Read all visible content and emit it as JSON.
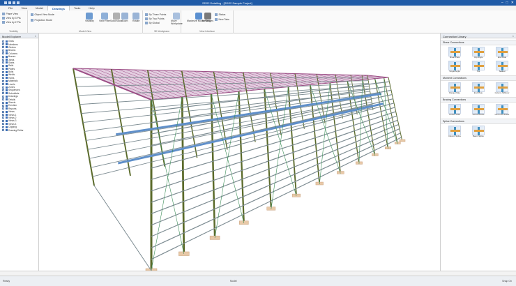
{
  "app": {
    "title": "SDS2 Detailing - [SDS2 Sample Project]",
    "window_controls": [
      "–",
      "□",
      "✕"
    ]
  },
  "menu": {
    "tabs": [
      "File",
      "View",
      "Model",
      "Drawings",
      "Tools",
      "Help"
    ],
    "active_index": 3
  },
  "ribbon": {
    "groups": [
      {
        "label": "Visibility"
      },
      {
        "label": "Model View"
      },
      {
        "label": "3D Workplane"
      },
      {
        "label": "View Interface"
      }
    ],
    "buttons": {
      "plane_view": "Plane View",
      "view_by_3pts": "View by 3 Pts",
      "view_by_2pts": "View by 2 Pts",
      "object_view": "Object View Mode",
      "projection": "Projection Mode",
      "visibility": "Visibility",
      "view_filter": "View Filter",
      "solid_mode": "Solid Mode",
      "zoom": "Zoom",
      "rotate": "Rotate",
      "by_three_points": "By Three Points",
      "by_two_points": "By Two Points",
      "by_global": "By Global",
      "move_workplane": "Move Workplane",
      "maximize_view": "Maximize Model View",
      "messages": "Messages",
      "status": "Status",
      "new_tabs": "New Tabs"
    }
  },
  "left_panel": {
    "title": "Model Explorer",
    "tree": [
      "Grids",
      "Members",
      "Girders",
      "Beams",
      "Columns",
      "Braces",
      "Joists",
      "Stairs",
      "Rails",
      "Plates",
      "Bolts",
      "Welds",
      "Holes",
      "Materials",
      "Levels",
      "Zones",
      "Sequences",
      "Submittals",
      "Drawings",
      "Details",
      "Sheets",
      "Erection",
      "Reports",
      "Views",
      "Views 1",
      "Views 2",
      "Views 3",
      "Views 4",
      "Clipping",
      "Drawing Editor"
    ]
  },
  "right_panel": {
    "title": "Connection Library",
    "sections": [
      {
        "label": "Shear Connections",
        "items": [
          "Shear Plate",
          "Clip Angle",
          "End Plate",
          "Single Angle",
          "Tee",
          "Seated"
        ]
      },
      {
        "label": "Moment Connections",
        "items": [
          "Flange Plate",
          "End Plate",
          "Column Stiffener"
        ]
      },
      {
        "label": "Bracing Connections",
        "items": [
          "Gusset Plate",
          "Vertical Brace",
          "Horizontal Brace"
        ]
      },
      {
        "label": "Splice Connections",
        "items": [
          "Column Splice",
          "Beam Splice"
        ]
      }
    ]
  },
  "status": {
    "left": "Ready",
    "mid": "Model",
    "right": "Snap On"
  },
  "colors": {
    "titlebar": "#1f5aa6",
    "column": "#5a6a2a",
    "girt": "#7d8c92",
    "roof": "#9c4e86",
    "footing": "#e8c9a8"
  }
}
